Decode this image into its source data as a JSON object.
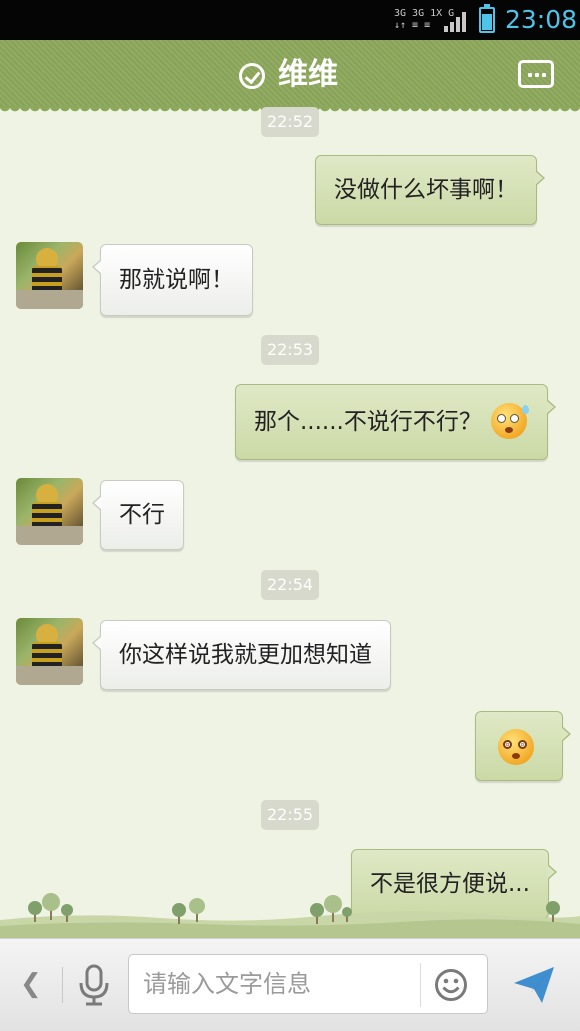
{
  "status_bar": {
    "network_top": "3G 3G 1X G",
    "network_bottom": "↓↑ ≡ ≡",
    "time": "23:08"
  },
  "header": {
    "title": "维维",
    "status_icon": "check-circle-icon",
    "menu_icon": "more-menu-icon"
  },
  "messages": [
    {
      "kind": "time",
      "text": "22:52"
    },
    {
      "kind": "out",
      "text": "没做什么坏事啊！"
    },
    {
      "kind": "in",
      "text": "那就说啊！"
    },
    {
      "kind": "time",
      "text": "22:53"
    },
    {
      "kind": "out",
      "text": "那个......不说行不行？",
      "emoji": "sweat-emoji-icon"
    },
    {
      "kind": "in",
      "text": "不行"
    },
    {
      "kind": "time",
      "text": "22:54"
    },
    {
      "kind": "in",
      "text": "你这样说我就更加想知道"
    },
    {
      "kind": "out",
      "text": "",
      "emoji": "dizzy-emoji-icon"
    },
    {
      "kind": "time",
      "text": "22:55"
    },
    {
      "kind": "out",
      "text": "不是很方便说..."
    }
  ],
  "input_bar": {
    "placeholder": "请输入文字信息",
    "value": ""
  },
  "colors": {
    "header": "#8ca85b",
    "outgoing_bubble": "#d3e0b2",
    "incoming_bubble": "#ffffff",
    "status_accent": "#4fc3e8",
    "background": "#eef3e4"
  }
}
